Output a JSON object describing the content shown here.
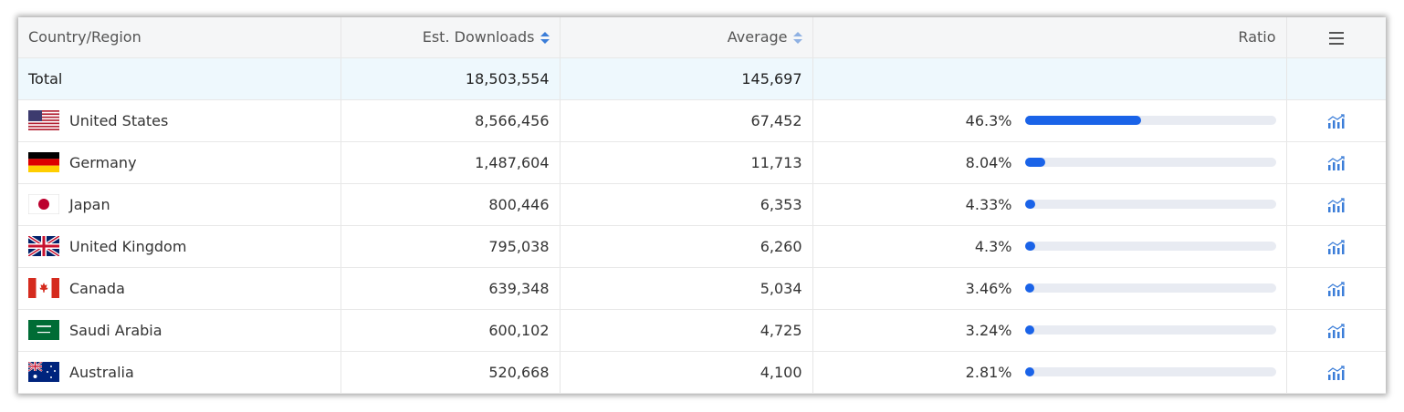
{
  "header": {
    "country": "Country/Region",
    "downloads": "Est. Downloads",
    "average": "Average",
    "ratio": "Ratio"
  },
  "total": {
    "label": "Total",
    "downloads": "18,503,554",
    "average": "145,697"
  },
  "rows": [
    {
      "name": "United States",
      "downloads": "8,566,456",
      "average": "67,452",
      "ratio": "46.3%",
      "ratio_value": 46.3
    },
    {
      "name": "Germany",
      "downloads": "1,487,604",
      "average": "11,713",
      "ratio": "8.04%",
      "ratio_value": 8.04
    },
    {
      "name": "Japan",
      "downloads": "800,446",
      "average": "6,353",
      "ratio": "4.33%",
      "ratio_value": 4.33
    },
    {
      "name": "United Kingdom",
      "downloads": "795,038",
      "average": "6,260",
      "ratio": "4.3%",
      "ratio_value": 4.3
    },
    {
      "name": "Canada",
      "downloads": "639,348",
      "average": "5,034",
      "ratio": "3.46%",
      "ratio_value": 3.46
    },
    {
      "name": "Saudi Arabia",
      "downloads": "600,102",
      "average": "4,725",
      "ratio": "3.24%",
      "ratio_value": 3.24
    },
    {
      "name": "Australia",
      "downloads": "520,668",
      "average": "4,100",
      "ratio": "2.81%",
      "ratio_value": 2.81
    }
  ],
  "colors": {
    "accent": "#1a63e8",
    "bar_track": "#e8ebf2",
    "total_bg": "#eef8fd",
    "header_bg": "#f5f6f7",
    "icon": "#3b7dd8"
  },
  "icons": {
    "menu": "hamburger-menu-icon",
    "trend": "bar-chart-trend-icon",
    "sort": "sort-arrows-icon"
  }
}
